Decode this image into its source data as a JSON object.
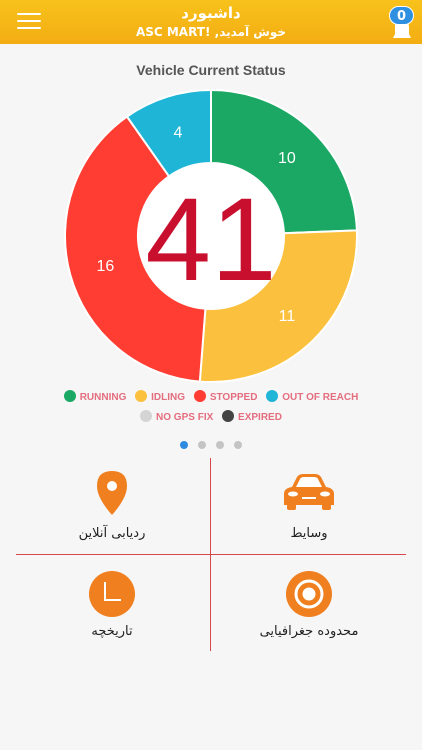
{
  "header": {
    "title": "داشبورد",
    "subtitle": "ASC MART! ,خوش آمدید",
    "notification_count": "0"
  },
  "chart_data": {
    "type": "pie",
    "title": "Vehicle Current Status",
    "total": "41",
    "slices": [
      {
        "label": "RUNNING",
        "value": 10,
        "color": "#1aa864"
      },
      {
        "label": "IDLING",
        "value": 11,
        "color": "#fbc13e"
      },
      {
        "label": "STOPPED",
        "value": 16,
        "color": "#ff3d32"
      },
      {
        "label": "OUT OF REACH",
        "value": 4,
        "color": "#1fb5d6"
      }
    ],
    "legend": [
      {
        "label": "RUNNING",
        "color": "#1aa864"
      },
      {
        "label": "IDLING",
        "color": "#fbc13e"
      },
      {
        "label": "STOPPED",
        "color": "#ff3d32"
      },
      {
        "label": "OUT OF REACH",
        "color": "#1fb5d6"
      },
      {
        "label": "NO GPS FIX",
        "color": "#d4d4d4"
      },
      {
        "label": "EXPIRED",
        "color": "#444444"
      }
    ]
  },
  "pager": {
    "count": 4,
    "active": 0
  },
  "menu": {
    "vehicles_label": "وسایط",
    "tracking_label": "ردیابی آنلاین",
    "geofence_label": "محدوده جغرافیایی",
    "history_label": "تاریخچه"
  },
  "colors": {
    "accent": "#f3ad13",
    "icon": "#f07f1f",
    "divider": "#d7484e",
    "total": "#c8102e"
  }
}
